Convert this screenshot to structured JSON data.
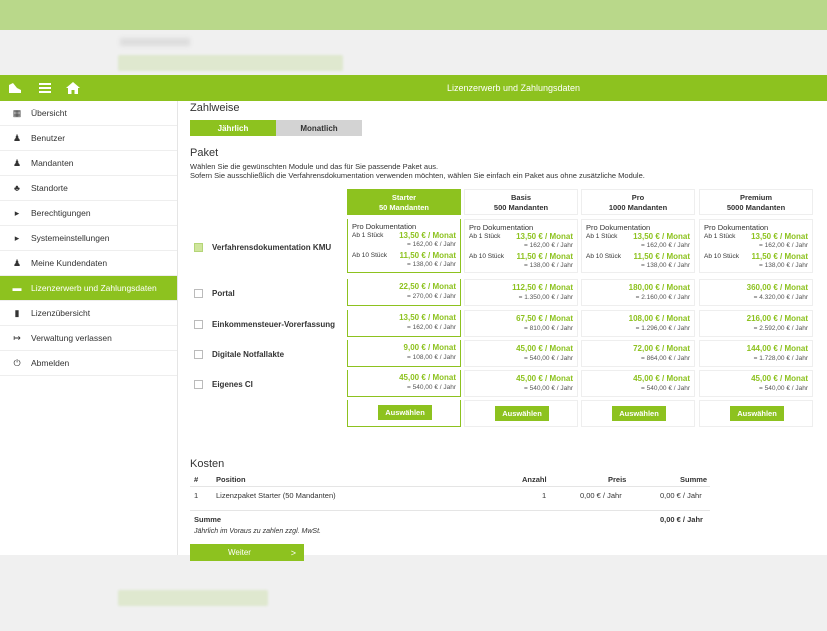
{
  "app_title": "Lizenzerwerb und Zahlungsdaten",
  "topbar_icons": [
    "shoe-logo-icon",
    "menu-icon",
    "home-icon"
  ],
  "sidebar": {
    "items": [
      {
        "label": "Übersicht",
        "icon": "table-icon",
        "active": false
      },
      {
        "label": "Benutzer",
        "icon": "user-icon",
        "active": false
      },
      {
        "label": "Mandanten",
        "icon": "users-icon",
        "active": false
      },
      {
        "label": "Standorte",
        "icon": "sitemap-icon",
        "active": false
      },
      {
        "label": "Berechtigungen",
        "icon": "caret-right-icon",
        "active": false
      },
      {
        "label": "Systemeinstellungen",
        "icon": "caret-right-icon",
        "active": false
      },
      {
        "label": "Meine Kundendaten",
        "icon": "users-icon",
        "active": false
      },
      {
        "label": "Lizenzerwerb und Zahlungsdaten",
        "icon": "credit-card-icon",
        "active": true
      },
      {
        "label": "Lizenzübersicht",
        "icon": "file-icon",
        "active": false
      },
      {
        "label": "Verwaltung verlassen",
        "icon": "sign-out-icon",
        "active": false
      },
      {
        "label": "Abmelden",
        "icon": "power-icon",
        "active": false
      }
    ]
  },
  "payment": {
    "heading": "Zahlweise",
    "options": [
      "Jährlich",
      "Monatlich"
    ],
    "selected": "Jährlich"
  },
  "package": {
    "heading": "Paket",
    "intro_line1": "Wählen Sie die gewünschten Module und das für Sie passende Paket aus.",
    "intro_line2": "Sofern Sie ausschließlich die Verfahrensdokumentation verwenden möchten, wählen Sie einfach ein Paket aus ohne zusätzliche Module.",
    "tiers": [
      {
        "name": "Starter",
        "mandanten": "50 Mandanten",
        "selected": true
      },
      {
        "name": "Basis",
        "mandanten": "500 Mandanten",
        "selected": false
      },
      {
        "name": "Pro",
        "mandanten": "1000 Mandanten",
        "selected": false
      },
      {
        "name": "Premium",
        "mandanten": "5000 Mandanten",
        "selected": false
      }
    ],
    "vd_row": {
      "label": "Verfahrensdokumentation KMU",
      "checked": true,
      "pro_label": "Pro Dokumentation",
      "ab1_label": "Ab 1 Stück",
      "ab10_label": "Ab 10 Stück",
      "ab1_monat": [
        "13,50 € / Monat",
        "13,50 € / Monat",
        "13,50 € / Monat",
        "13,50 € / Monat"
      ],
      "ab1_jahr": [
        "= 162,00 € / Jahr",
        "= 162,00 € / Jahr",
        "= 162,00 € / Jahr",
        "= 162,00 € / Jahr"
      ],
      "ab10_monat": [
        "11,50 € / Monat",
        "11,50 € / Monat",
        "11,50 € / Monat",
        "11,50 € / Monat"
      ],
      "ab10_jahr": [
        "= 138,00 € / Jahr",
        "= 138,00 € / Jahr",
        "= 138,00 € / Jahr",
        "= 138,00 € / Jahr"
      ]
    },
    "modules": [
      {
        "label": "Portal",
        "checked": false,
        "monat": [
          "22,50 € / Monat",
          "112,50 € / Monat",
          "180,00 € / Monat",
          "360,00 € / Monat"
        ],
        "jahr": [
          "= 270,00 € / Jahr",
          "= 1.350,00 € / Jahr",
          "= 2.160,00 € / Jahr",
          "= 4.320,00 € / Jahr"
        ]
      },
      {
        "label": "Einkommensteuer-Vorerfassung",
        "checked": false,
        "monat": [
          "13,50 € / Monat",
          "67,50 € / Monat",
          "108,00 € / Monat",
          "216,00 € / Monat"
        ],
        "jahr": [
          "= 162,00 € / Jahr",
          "= 810,00 € / Jahr",
          "= 1.296,00 € / Jahr",
          "= 2.592,00 € / Jahr"
        ]
      },
      {
        "label": "Digitale Notfallakte",
        "checked": false,
        "monat": [
          "9,00 € / Monat",
          "45,00 € / Monat",
          "72,00 € / Monat",
          "144,00 € / Monat"
        ],
        "jahr": [
          "= 108,00 € / Jahr",
          "= 540,00 € / Jahr",
          "= 864,00 € / Jahr",
          "= 1.728,00 € / Jahr"
        ]
      },
      {
        "label": "Eigenes CI",
        "checked": false,
        "monat": [
          "45,00 € / Monat",
          "45,00 € / Monat",
          "45,00 € / Monat",
          "45,00 € / Monat"
        ],
        "jahr": [
          "= 540,00 € / Jahr",
          "= 540,00 € / Jahr",
          "= 540,00 € / Jahr",
          "= 540,00 € / Jahr"
        ]
      }
    ],
    "select_label": "Auswählen"
  },
  "costs": {
    "heading": "Kosten",
    "columns": {
      "nr": "#",
      "position": "Position",
      "anzahl": "Anzahl",
      "preis": "Preis",
      "summe": "Summe"
    },
    "rows": [
      {
        "nr": "1",
        "position": "Lizenzpaket Starter (50 Mandanten)",
        "anzahl": "1",
        "preis": "0,00 € / Jahr",
        "summe": "0,00 € / Jahr"
      }
    ],
    "total_label": "Summe",
    "total_value": "0,00 € / Jahr",
    "note": "Jährlich im Voraus zu zahlen zzgl. MwSt."
  },
  "next_button": {
    "label": "Weiter",
    "arrow": ">"
  },
  "colors": {
    "accent": "#8dc21f",
    "toggle_off": "#d3d3d3"
  }
}
